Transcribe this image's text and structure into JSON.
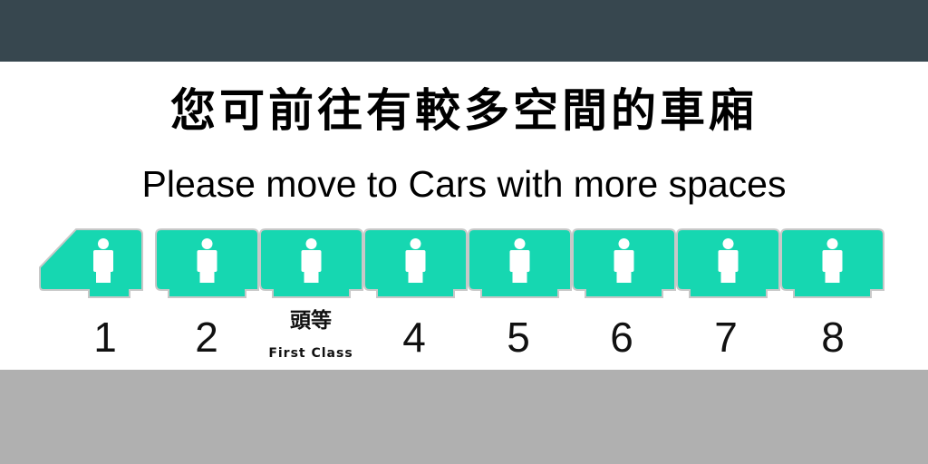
{
  "sign": {
    "title_zh": "您可前往有較多空間的車廂",
    "title_en": "Please move to Cars with more spaces"
  },
  "colors": {
    "top_bar": "#37474f",
    "bottom_bar": "#b0b0b0",
    "car_fill": "#16d7b1",
    "car_outline": "#c8c8c8"
  },
  "cars": [
    {
      "label": "1",
      "icon": "person-icon"
    },
    {
      "label": "2",
      "icon": "person-icon"
    },
    {
      "label_zh": "頭等",
      "label_en": "First Class",
      "icon": "person-icon"
    },
    {
      "label": "4",
      "icon": "person-icon"
    },
    {
      "label": "5",
      "icon": "person-icon"
    },
    {
      "label": "6",
      "icon": "person-icon"
    },
    {
      "label": "7",
      "icon": "person-icon"
    },
    {
      "label": "8",
      "icon": "person-icon"
    }
  ]
}
